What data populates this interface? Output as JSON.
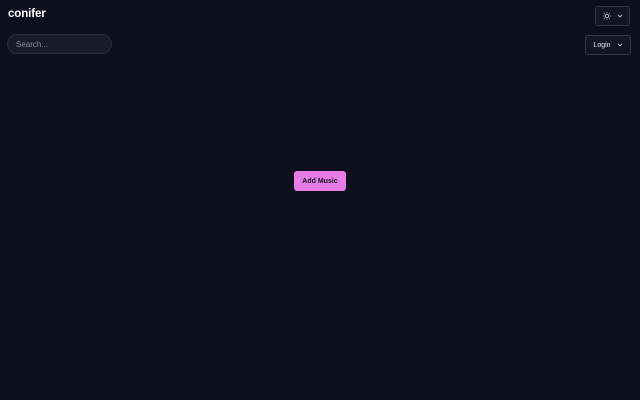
{
  "app": {
    "logo": "conifer"
  },
  "search": {
    "placeholder": "Search..."
  },
  "header": {
    "theme_icon": "sun-icon",
    "theme_chevron_icon": "chevron-down-icon",
    "login_label": "Login",
    "login_chevron_icon": "chevron-down-icon"
  },
  "main": {
    "add_music_label": "Add Music"
  },
  "colors": {
    "background": "#0f0e1f",
    "accent": "#e57ce8"
  }
}
